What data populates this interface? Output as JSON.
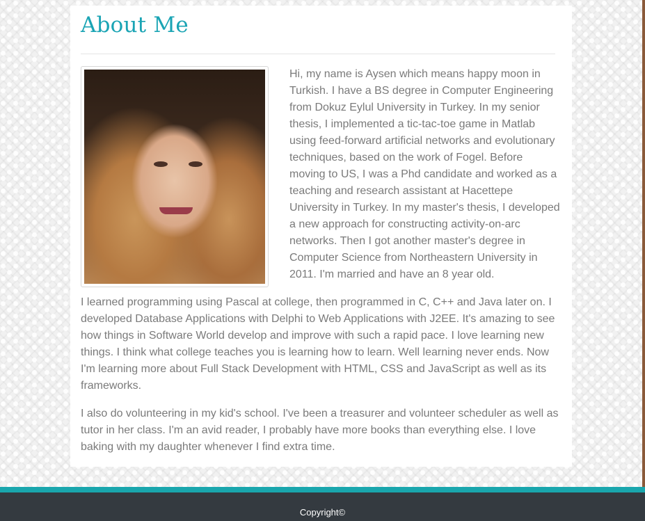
{
  "page": {
    "title": "About Me"
  },
  "about": {
    "photo_alt": "Portrait photo of Aysen",
    "paragraphs": [
      "Hi, my name is Aysen which means happy moon in Turkish. I have a BS degree in Computer Engineering from Dokuz Eylul University in Turkey. In my senior thesis, I implemented a tic-tac-toe game in Matlab using feed-forward artificial networks and evolutionary techniques, based on the work of Fogel. Before moving to US, I was a Phd candidate and worked as a teaching and research assistant at Hacettepe University in Turkey. In my master's thesis, I developed a new approach for constructing activity-on-arc networks. Then I got another master's degree in Computer Science from Northeastern University in 2011. I'm married and have an 8 year old.",
      "I learned programming using Pascal at college, then programmed in C, C++ and Java later on. I developed Database Applications with Delphi to Web Applications with J2EE. It's amazing to see how things in Software World develop and improve with such a rapid pace. I love learning new things. I think what college teaches you is learning how to learn. Well learning never ends. Now I'm learning more about Full Stack Development with HTML, CSS and JavaScript as well as its frameworks.",
      "I also do volunteering in my kid's school. I've been a treasurer and volunteer scheduler as well as tutor in her class. I'm an avid reader, I probably have more books than everything else. I love baking with my daughter whenever I find extra time."
    ]
  },
  "footer": {
    "copyright": "Copyright©"
  },
  "colors": {
    "title": "#1aa4b4",
    "body_text": "#7a7a7a",
    "footer_bg": "#343a40",
    "footer_stripe": "#19a6ad",
    "card_bg": "#ffffff"
  }
}
